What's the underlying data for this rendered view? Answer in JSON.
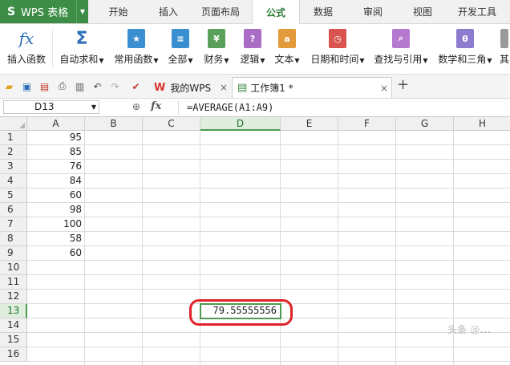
{
  "app": {
    "title": "WPS 表格",
    "logo": "S"
  },
  "menu_tabs": [
    "开始",
    "插入",
    "页面布局",
    "公式",
    "数据",
    "审阅",
    "视图",
    "开发工具"
  ],
  "active_menu_tab": "公式",
  "ribbon": [
    {
      "label": "插入函数",
      "icon": "fx-icon",
      "glyph": "fx"
    },
    {
      "label": "自动求和",
      "icon": "sigma-icon",
      "glyph": "Σ",
      "dropdown": true
    },
    {
      "label": "常用函数",
      "icon": "star-book-icon",
      "glyph": "★",
      "dropdown": true
    },
    {
      "label": "全部",
      "icon": "list-book-icon",
      "glyph": "≡",
      "dropdown": true
    },
    {
      "label": "财务",
      "icon": "finance-book-icon",
      "glyph": "¥",
      "dropdown": true
    },
    {
      "label": "逻辑",
      "icon": "logic-book-icon",
      "glyph": "?",
      "dropdown": true
    },
    {
      "label": "文本",
      "icon": "text-book-icon",
      "glyph": "a",
      "dropdown": true
    },
    {
      "label": "日期和时间",
      "icon": "clock-book-icon",
      "glyph": "◷",
      "dropdown": true
    },
    {
      "label": "查找与引用",
      "icon": "search-book-icon",
      "glyph": "⌕",
      "dropdown": true
    },
    {
      "label": "数学和三角",
      "icon": "theta-book-icon",
      "glyph": "θ",
      "dropdown": true
    },
    {
      "label": "其",
      "icon": "more-book-icon",
      "glyph": "",
      "dropdown": false
    }
  ],
  "doc_tabs": [
    {
      "label": "我的WPS",
      "icon": "wps-logo-icon"
    },
    {
      "label": "工作簿1 *",
      "icon": "sheet-doc-icon"
    }
  ],
  "formula_bar": {
    "cell_ref": "D13",
    "fx": "fx",
    "formula": "=AVERAGE(A1:A9)"
  },
  "columns": [
    "A",
    "B",
    "C",
    "D",
    "E",
    "F",
    "G",
    "H"
  ],
  "rows": [
    "1",
    "2",
    "3",
    "4",
    "5",
    "6",
    "7",
    "8",
    "9",
    "10",
    "11",
    "12",
    "13",
    "14",
    "15",
    "16"
  ],
  "column_a_values": [
    "95",
    "85",
    "76",
    "84",
    "60",
    "98",
    "100",
    "58",
    "60"
  ],
  "active_cell": {
    "ref": "D13",
    "value": "79.55555556"
  },
  "watermark": "头条 @..."
}
